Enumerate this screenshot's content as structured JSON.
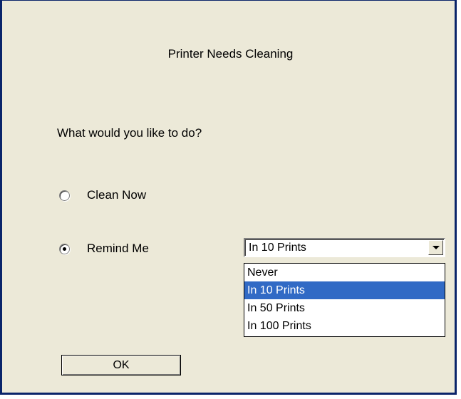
{
  "dialog": {
    "title": "Printer Needs Cleaning",
    "prompt": "What would you like to do?",
    "options": {
      "clean_now": {
        "label": "Clean Now",
        "checked": false
      },
      "remind_me": {
        "label": "Remind Me",
        "checked": true
      }
    },
    "reminder_combo": {
      "selected": "In 10 Prints",
      "items": [
        "Never",
        "In 10 Prints",
        "In 50 Prints",
        "In 100 Prints"
      ],
      "highlighted_index": 1
    },
    "ok_label": "OK"
  },
  "colors": {
    "dialog_bg": "#ece9d8",
    "frame": "#0a246a",
    "selection": "#316ac5"
  }
}
